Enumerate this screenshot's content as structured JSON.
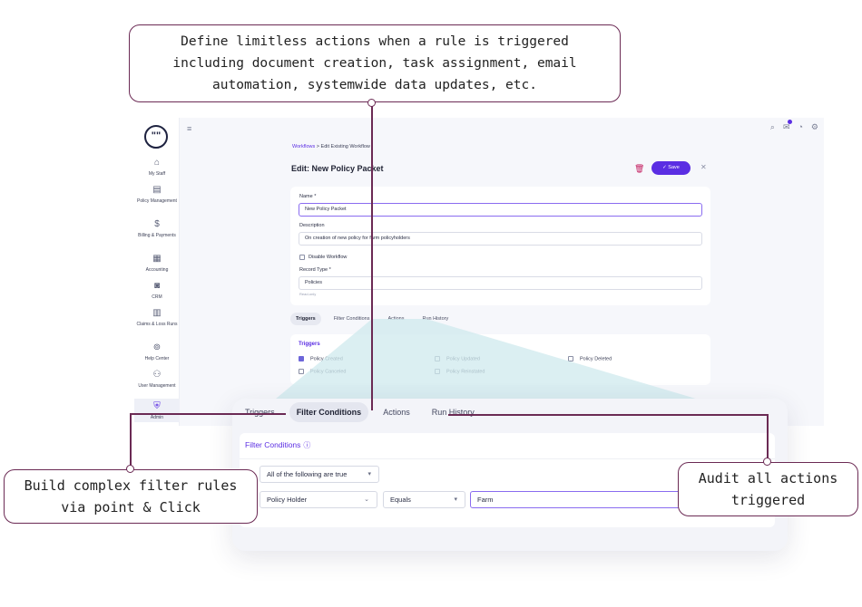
{
  "callouts": {
    "top": [
      "Define limitless actions when a rule is triggered",
      "including document creation, task assignment, email",
      "automation, systemwide data updates, etc."
    ],
    "left": [
      "Build complex filter rules",
      "via point & Click"
    ],
    "right": [
      "Audit all actions",
      "triggered"
    ]
  },
  "sidebar": {
    "logo": "\"\"",
    "items": [
      {
        "label": "My Staff",
        "icon": "home-icon"
      },
      {
        "label": "Policy Management",
        "icon": "document-icon"
      },
      {
        "label": "Billing & Payments",
        "icon": "dollar-icon"
      },
      {
        "label": "Accounting",
        "icon": "ledger-icon"
      },
      {
        "label": "CRM",
        "icon": "contact-icon"
      },
      {
        "label": "Claims & Loss Runs",
        "icon": "clipboard-icon"
      },
      {
        "label": "Help Center",
        "icon": "help-icon"
      },
      {
        "label": "User Management",
        "icon": "users-icon"
      },
      {
        "label": "Admin",
        "icon": "shield-icon"
      }
    ]
  },
  "topbar": {
    "menu_icon": "≡",
    "icons": [
      "search-icon",
      "notification-icon",
      "bell-icon",
      "settings-icon"
    ]
  },
  "breadcrumb": {
    "parent": "Workflows",
    "separator": ">",
    "current": "Edit Existing Workflow"
  },
  "page": {
    "title": "Edit: New Policy Packet",
    "save_label": "Save"
  },
  "form": {
    "name_label": "Name *",
    "name_value": "New Policy Packet",
    "description_label": "Description",
    "description_value": "On creation of new policy for farm policyholders",
    "disable_label": "Disable Workflow",
    "record_type_label": "Record Type *",
    "record_type_value": "Policies",
    "record_type_hint": "Read-only"
  },
  "tabs": [
    "Triggers",
    "Filter Conditions",
    "Actions",
    "Run History"
  ],
  "triggers": {
    "title": "Triggers",
    "items": [
      {
        "label": "Policy Created",
        "checked": true
      },
      {
        "label": "Policy Updated",
        "checked": false
      },
      {
        "label": "Policy Deleted",
        "checked": false
      },
      {
        "label": "Policy Canceled",
        "checked": false
      },
      {
        "label": "Policy Reinstated",
        "checked": false
      }
    ]
  },
  "filter": {
    "title": "Filter Conditions",
    "match_mode": "All of the following are true",
    "field": "Policy Holder",
    "operator": "Equals",
    "value": "Farm"
  },
  "colors": {
    "accent": "#5b2ee3",
    "callout_border": "#6b2a54",
    "funnel": "#cfe9ee"
  }
}
